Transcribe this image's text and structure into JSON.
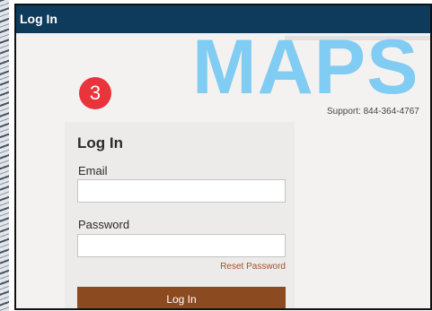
{
  "window": {
    "title": "Log In"
  },
  "branding": {
    "logo_text": "MAPS",
    "logo_color": "#80ccf2",
    "support_text": "Support: 844-364-4767"
  },
  "step_marker": {
    "number": "3",
    "color": "#e8343a"
  },
  "login_form": {
    "heading": "Log In",
    "email_label": "Email",
    "email_value": "",
    "password_label": "Password",
    "password_value": "",
    "reset_password_label": "Reset Password",
    "submit_label": "Log In"
  },
  "colors": {
    "header_bar": "#0e3a5c",
    "submit_button": "#8c4a21",
    "link": "#a0522d",
    "panel_background": "#ecebe9"
  }
}
